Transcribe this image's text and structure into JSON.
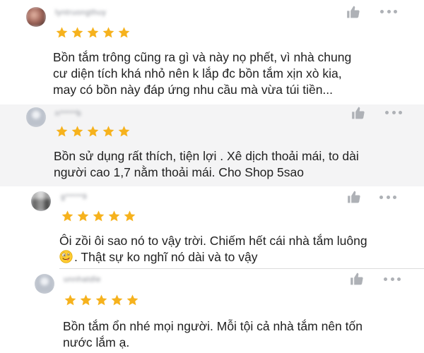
{
  "colors": {
    "star": "#f6b21d",
    "icon": "#aeb1b6",
    "shaded_row": "#f4f4f5"
  },
  "reviews": [
    {
      "username": "lyntruongthuy",
      "avatar": "user-photo",
      "rating": 5,
      "lines": [
        "Bồn tắm trông cũng ra gì và này nọ phết, vì nhà chung",
        "cư diện tích khá nhỏ nên k lắp đc bồn tắm xịn xò kia,",
        "may có bồn này đáp ứng nhu cầu mà vừa túi tiền..."
      ]
    },
    {
      "username": "n*****b",
      "avatar": "default-avatar",
      "rating": 5,
      "lines": [
        "Bồn sử dụng rất thích, tiện lợi . Xê dịch thoải mái, to dài",
        "người cao 1,7 nằm thoải mái. Cho Shop 5sao"
      ]
    },
    {
      "username": "g*****9",
      "avatar": "pixel-avatar",
      "rating": 5,
      "lines": [
        "Ôi zồi ôi sao nó to vậy trời. Chiếm hết cái nhà tắm luông",
        ". Thật sự ko nghĩ nó dài và to vậy"
      ],
      "emoji": "zany-face-emoji"
    },
    {
      "username": "unnhatdle",
      "avatar": "default-avatar",
      "rating": 5,
      "lines": [
        "Bồn tắm ổn nhé mọi người. Mỗi tội cả nhà tắm nên tốn",
        "nước lắm ạ."
      ]
    }
  ]
}
